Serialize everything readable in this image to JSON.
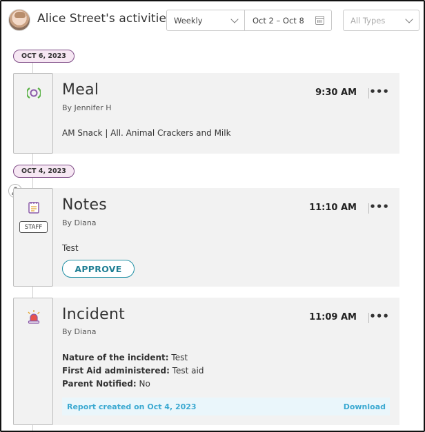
{
  "header": {
    "title": "Alice Street's activities",
    "period": "Weekly",
    "date_range": "Oct 2 – Oct 8",
    "type_filter_placeholder": "All Types"
  },
  "groups": [
    {
      "date": "OCT 6, 2023",
      "activities": [
        {
          "type": "Meal",
          "icon": "meal-icon",
          "author": "By Jennifer H",
          "time": "9:30 AM",
          "body": "AM Snack | All. Animal Crackers and Milk"
        }
      ]
    },
    {
      "date": "OCT 4, 2023",
      "activities": [
        {
          "type": "Notes",
          "icon": "notes-icon",
          "badge": "STAFF",
          "author": "By Diana",
          "time": "11:10 AM",
          "body": "Test",
          "action": "APPROVE"
        },
        {
          "type": "Incident",
          "icon": "siren-icon",
          "author": "By Diana",
          "time": "11:09 AM",
          "fields": [
            {
              "label": "Nature of the incident:",
              "value": "Test"
            },
            {
              "label": "First Aid administered:",
              "value": "Test aid"
            },
            {
              "label": "Parent Notified:",
              "value": "No"
            }
          ],
          "report_text": "Report created on Oct 4, 2023",
          "download_label": "Download"
        }
      ]
    }
  ],
  "colors": {
    "date_pill_border": "#7d4a85",
    "date_pill_bg": "#f6e7f3",
    "accent_teal": "#1f8fa4",
    "report_link": "#3ba9d1",
    "card_bg": "#f2f2f2"
  }
}
